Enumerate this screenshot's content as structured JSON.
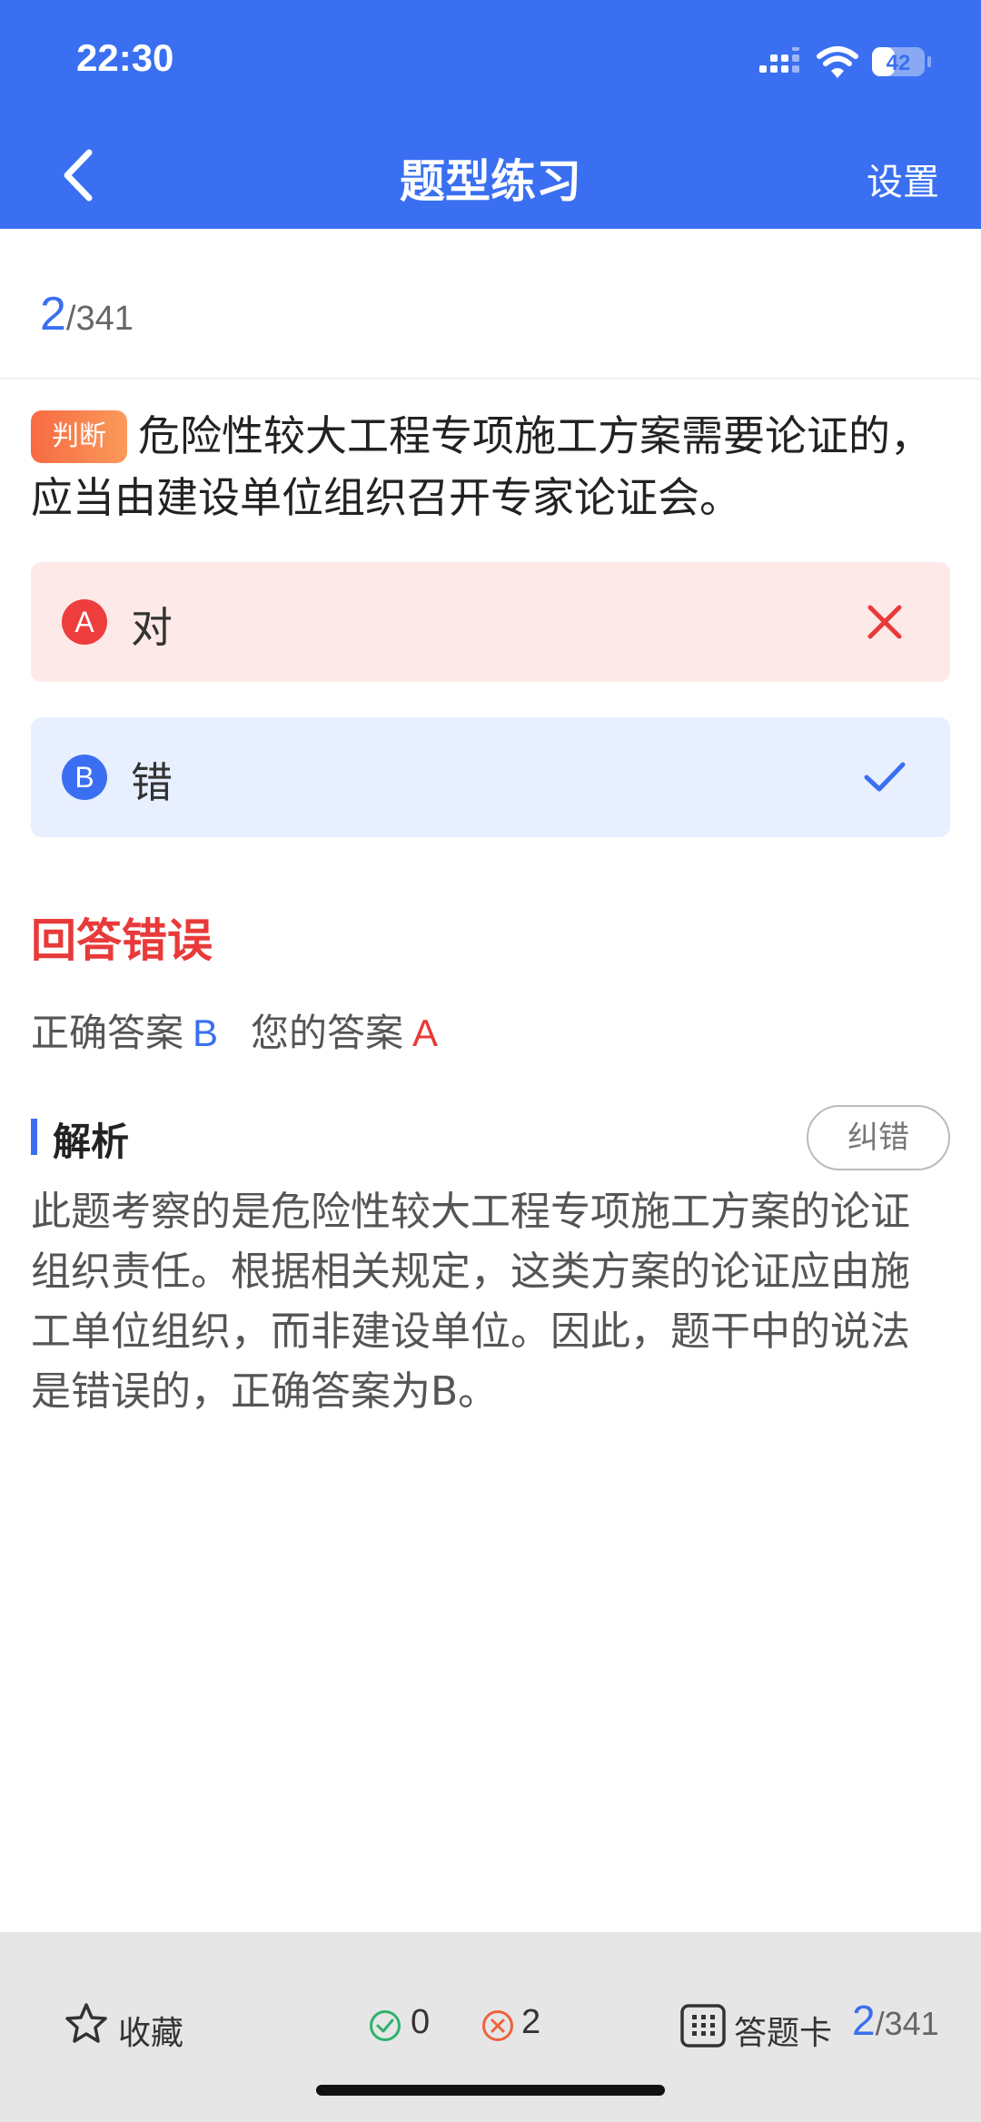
{
  "status_bar": {
    "time": "22:30",
    "battery": "42"
  },
  "header": {
    "title": "题型练习",
    "settings_label": "设置"
  },
  "progress": {
    "current": "2",
    "total": "/341"
  },
  "question": {
    "type_tag": "判断",
    "text": "危险性较大工程专项施工方案需要论证的，应当由建设单位组织召开专家论证会。"
  },
  "options": [
    {
      "letter": "A",
      "text": "对",
      "state": "wrong"
    },
    {
      "letter": "B",
      "text": "错",
      "state": "correct"
    }
  ],
  "result": {
    "status_text": "回答错误",
    "correct_label": "正确答案",
    "correct_value": "B",
    "your_label": "您的答案",
    "your_value": "A"
  },
  "analysis": {
    "title": "解析",
    "report_button": "纠错",
    "text": "此题考察的是危险性较大工程专项施工方案的论证组织责任。根据相关规定，这类方案的论证应由施工单位组织，而非建设单位。因此，题干中的说法是错误的，正确答案为B。"
  },
  "bottom_bar": {
    "favorite_label": "收藏",
    "correct_count": "0",
    "wrong_count": "2",
    "answer_card_label": "答题卡",
    "progress_current": "2",
    "progress_total": "/341"
  },
  "colors": {
    "primary": "#3a6ff1",
    "error": "#e83a3a",
    "tag": "#f86a43"
  },
  "icons": {
    "back": "chevron-left-icon",
    "wrong_mark": "close-icon",
    "correct_mark": "check-icon",
    "favorite": "star-icon",
    "correct_count": "check-circle-icon",
    "wrong_count": "x-circle-icon",
    "answer_card": "grid-icon"
  }
}
